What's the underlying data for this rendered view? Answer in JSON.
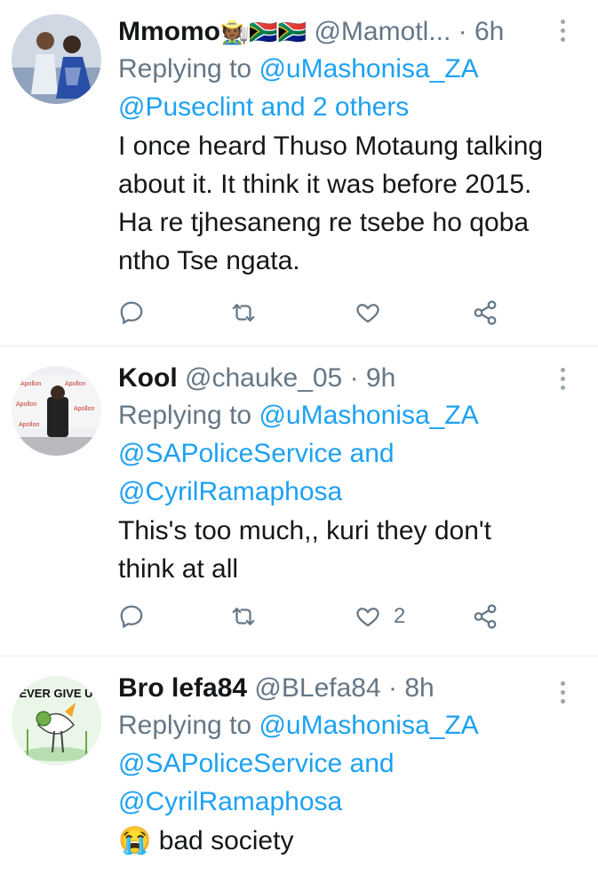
{
  "tweets": [
    {
      "name": "Mmomo",
      "emoji": "🧑🏾‍🌾🇿🇦🇿🇦",
      "handle": "@Mamotl...",
      "time": "· 6h",
      "replying_prefix": "Replying to",
      "replying_users": "@uMashonisa_ZA",
      "replying_line2": "@Puseclint and 2 others",
      "replying_line3": "",
      "text_lines": [
        "I once heard Thuso Motaung talking",
        "about it. It think it was before 2015.",
        "Ha re tjhesaneng re tsebe ho qoba",
        "ntho Tse ngata."
      ],
      "likes": ""
    },
    {
      "name": "Kool",
      "emoji": "",
      "handle": "@chauke_05",
      "time": "· 9h",
      "replying_prefix": "Replying to",
      "replying_users": "@uMashonisa_ZA",
      "replying_line2": "@SAPoliceService and",
      "replying_line3": "@CyrilRamaphosa",
      "text_lines": [
        "This's too much,, kuri they don't",
        "think at all"
      ],
      "likes": "2"
    },
    {
      "name": "Bro lefa84",
      "emoji": "",
      "handle": "@BLefa84",
      "time": "· 8h",
      "replying_prefix": "Replying to",
      "replying_users": "@uMashonisa_ZA",
      "replying_line2": "@SAPoliceService and",
      "replying_line3": "@CyrilRamaphosa",
      "text_lines": [
        "😭 bad society"
      ],
      "likes": ""
    }
  ],
  "avatar3_text": "EVER GIVE U",
  "icons": [
    "reply-icon",
    "retweet-icon",
    "like-icon",
    "share-icon",
    "more-icon"
  ],
  "colors": {
    "link": "#1da1f2",
    "muted": "#657786",
    "text": "#14171a",
    "divider": "#e6ecf0"
  }
}
